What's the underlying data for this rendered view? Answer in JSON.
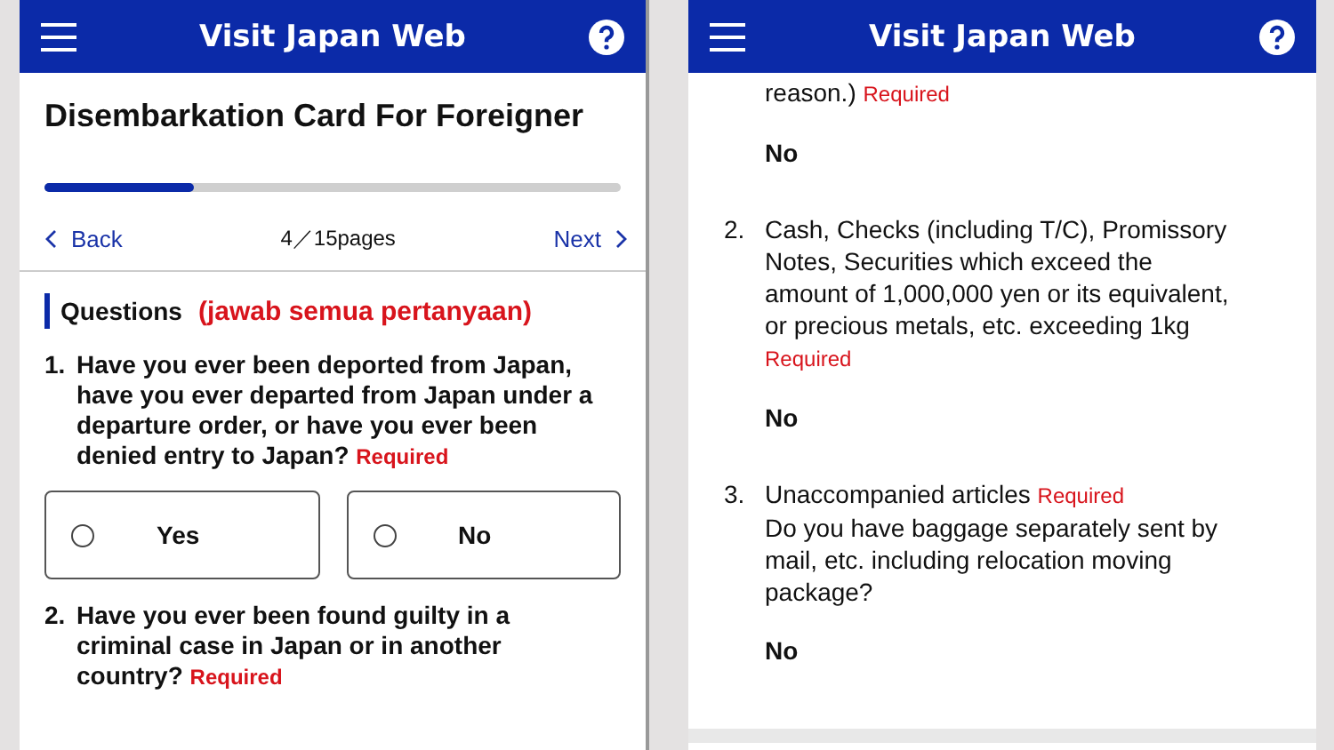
{
  "screens": [
    {
      "header": {
        "title": "Visit Japan Web"
      },
      "page_title": "Disembarkation Card For Foreigner",
      "progress": {
        "level": 0.26
      },
      "nav": {
        "back": "Back",
        "page": "4／15pages",
        "next": "Next"
      },
      "section": {
        "label": "Questions",
        "note": "(jawab semua pertanyaan)"
      },
      "questions": [
        {
          "kind": "choice",
          "number": "1.",
          "text": "Have you ever been deported from Japan, have you ever departed from Japan under a departure order, or have you ever been denied entry to Japan?",
          "required": "Required",
          "options": [
            {
              "label": "Yes",
              "selected": false
            },
            {
              "label": "No",
              "selected": false
            }
          ]
        },
        {
          "kind": "choice",
          "number": "2.",
          "text": "Have you ever been found guilty in a criminal case in Japan or in another country?",
          "required": "Required"
        }
      ]
    },
    {
      "header": {
        "title": "Visit Japan Web"
      },
      "questions": [
        {
          "kind": "answer",
          "text": "reason.)",
          "required": "Required",
          "answer": "No"
        },
        {
          "kind": "answer",
          "number": "2.",
          "text": "Cash, Checks (including T/C), Promissory Notes, Securities which exceed the amount of 1,000,000 yen or its equivalent, or precious metals, etc. exceeding 1kg",
          "required": "Required",
          "answer": "No"
        },
        {
          "kind": "answer",
          "number": "3.",
          "text": "Unaccompanied articles",
          "required": "Required",
          "detail": "Do you have baggage separately sent by mail, etc. including relocation moving package?",
          "answer": "No"
        }
      ]
    }
  ]
}
